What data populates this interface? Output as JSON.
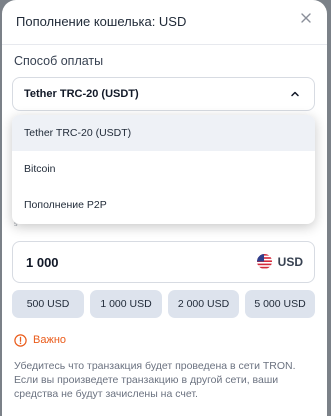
{
  "header": {
    "title": "Пополнение кошелька: USD",
    "close_icon": "close-icon"
  },
  "payment": {
    "label": "Способ оплаты",
    "selected": "Tether TRC-20 (USDT)",
    "chevron_icon": "chevron-up-icon",
    "options": [
      "Tether TRC-20 (USDT)",
      "Bitcoin",
      "Пополнение P2P"
    ]
  },
  "amount": {
    "value": "1 000",
    "currency": "USD",
    "flag_icon": "us-flag-icon"
  },
  "presets": [
    "500 USD",
    "1 000 USD",
    "2 000 USD",
    "5 000 USD"
  ],
  "warning": {
    "icon": "warning-icon",
    "label": "Важно",
    "lines": [
      "Убедитесь что транзакция будет проведена в сети TRON.",
      "Если вы произведете транзакцию в другой сети, ваши",
      "средства не будут зачислены на счет."
    ]
  },
  "colors": {
    "overlay": "#7b8188",
    "chip_bg": "#dde3ed",
    "warning": "#ea5b1a",
    "selected_option_bg": "#eef1f6"
  }
}
